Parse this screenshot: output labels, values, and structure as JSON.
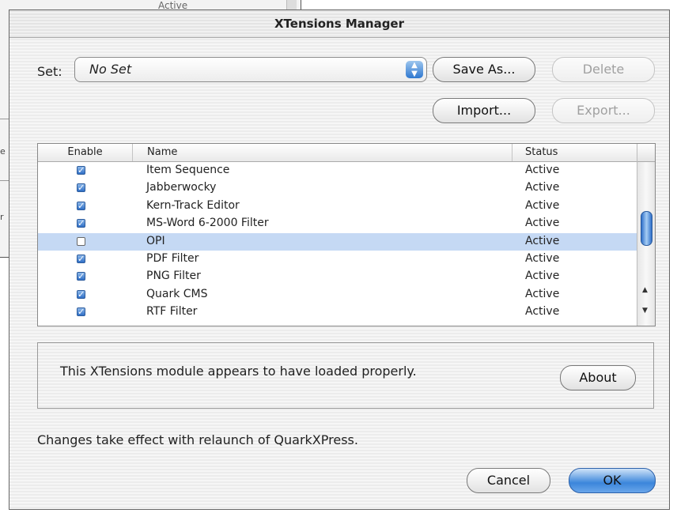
{
  "background_window": {
    "fragment_text": "Active",
    "side_letters": [
      "e",
      "r"
    ]
  },
  "dialog": {
    "title": "XTensions Manager",
    "set_label": "Set:",
    "set_value": "No Set",
    "buttons": {
      "save_as": "Save As...",
      "delete": "Delete",
      "import": "Import...",
      "export": "Export...",
      "about": "About",
      "cancel": "Cancel",
      "ok": "OK"
    },
    "table": {
      "columns": [
        "Enable",
        "Name",
        "Status"
      ],
      "rows": [
        {
          "enabled": true,
          "name": "Item Sequence",
          "status": "Active",
          "selected": false
        },
        {
          "enabled": true,
          "name": "Jabberwocky",
          "status": "Active",
          "selected": false
        },
        {
          "enabled": true,
          "name": "Kern-Track Editor",
          "status": "Active",
          "selected": false
        },
        {
          "enabled": true,
          "name": "MS-Word 6-2000 Filter",
          "status": "Active",
          "selected": false
        },
        {
          "enabled": false,
          "name": "OPI",
          "status": "Active",
          "selected": true
        },
        {
          "enabled": true,
          "name": "PDF Filter",
          "status": "Active",
          "selected": false
        },
        {
          "enabled": true,
          "name": "PNG Filter",
          "status": "Active",
          "selected": false
        },
        {
          "enabled": true,
          "name": "Quark CMS",
          "status": "Active",
          "selected": false
        },
        {
          "enabled": true,
          "name": "RTF Filter",
          "status": "Active",
          "selected": false
        }
      ]
    },
    "info_message": "This XTensions module appears to have loaded properly.",
    "relaunch_note": "Changes take effect with relaunch of QuarkXPress.",
    "colors": {
      "selection": "#c5d9f4",
      "accent": "#3b86db"
    }
  }
}
